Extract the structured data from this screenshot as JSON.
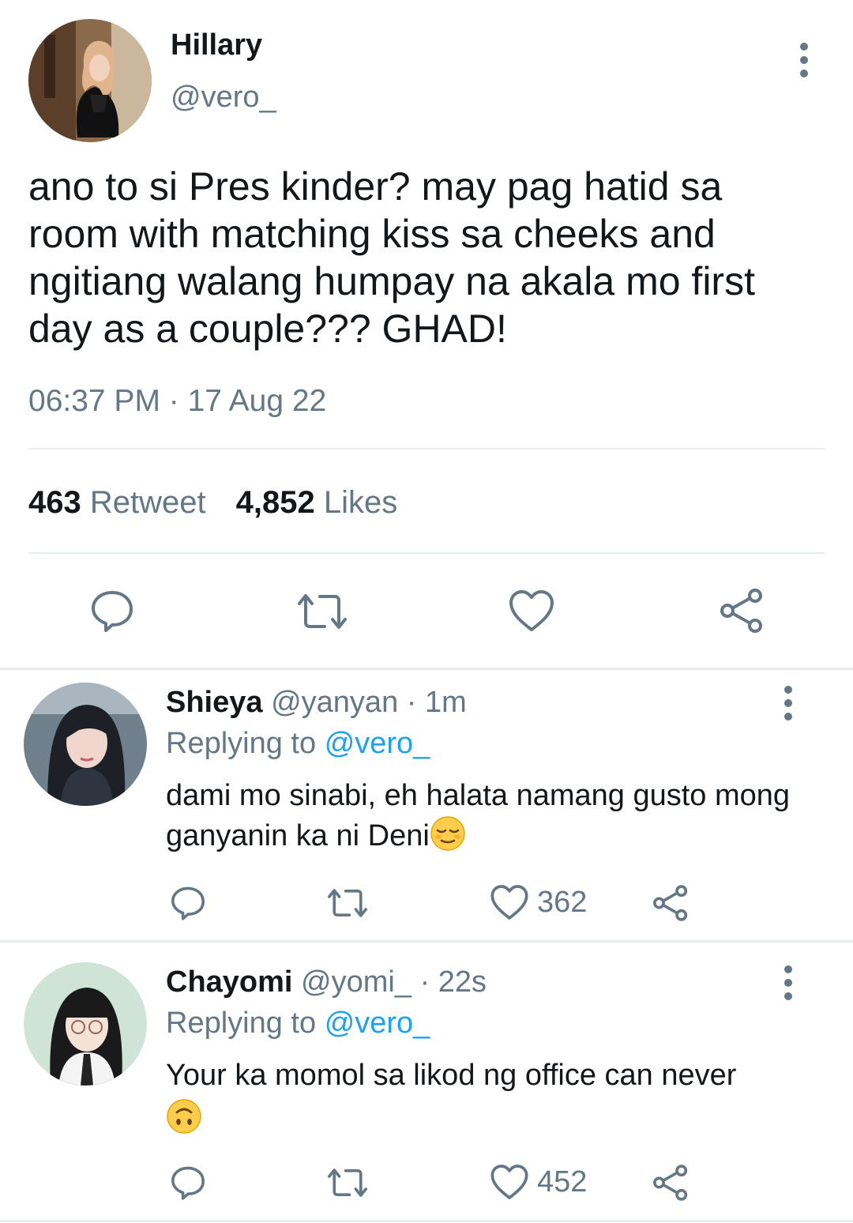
{
  "main_tweet": {
    "display_name": "Hillary",
    "handle": "@vero_",
    "text": "ano to si Pres kinder? may pag hatid sa room with matching kiss sa cheeks and ngitiang walang humpay na akala mo first day as a couple??? GHAD!",
    "timestamp": "06:37 PM · 17 Aug 22",
    "retweet_count": "463",
    "retweet_label": "Retweet",
    "like_count": "4,852",
    "like_label": "Likes",
    "actions": [
      "reply-icon",
      "retweet-icon",
      "heart-icon",
      "share-icon"
    ]
  },
  "replies": [
    {
      "display_name": "Shieya",
      "handle": "@yanyan",
      "age": "· 1m",
      "replying_prefix": "Replying to",
      "replying_to": "@vero_",
      "text": "dami mo sinabi, eh halata namang gusto mong ganyanin ka ni Deni",
      "emoji": "relieved-face-emoji",
      "like_count": "362"
    },
    {
      "display_name": "Chayomi",
      "handle": "@yomi_",
      "age": "· 22s",
      "replying_prefix": "Replying to",
      "replying_to": "@vero_",
      "text": "Your ka momol sa likod ng office can never",
      "emoji": "upside-down-face-emoji",
      "like_count": "452"
    }
  ],
  "colors": {
    "text": "#14171a",
    "secondary": "#657786",
    "link": "#1da1f2",
    "divider": "#e6ecf0"
  }
}
